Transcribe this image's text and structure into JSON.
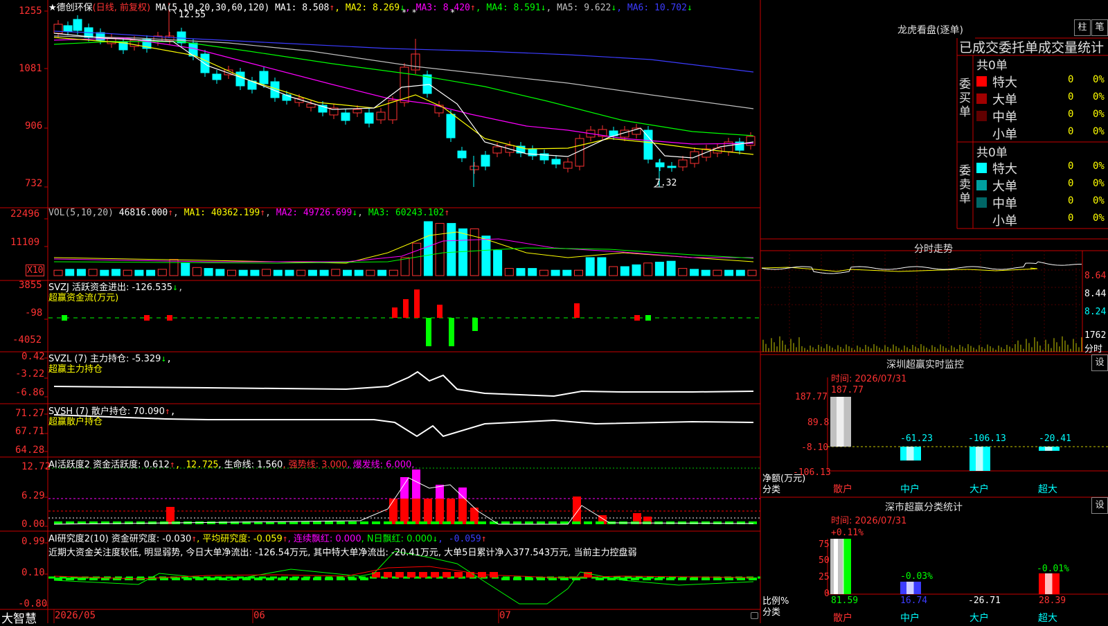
{
  "app": {
    "logo": "大智慧"
  },
  "stock": {
    "name": "★德创环保",
    "mode": "(日线, 前复权)",
    "high_marker": "12.55",
    "low_marker": "7.32"
  },
  "ma_header": {
    "prefix": "MA(5,10,20,30,60,120)",
    "items": [
      {
        "label": "MA1: 8.508",
        "arrow": "↑",
        "color": "#ffffff",
        "arrow_color": "#ff3232"
      },
      {
        "label": "MA2: 8.269",
        "arrow": "↓",
        "color": "#ffff00",
        "arrow_color": "#00ff00"
      },
      {
        "label": "MA3: 8.420",
        "arrow": "↑",
        "color": "#ff00ff",
        "arrow_color": "#ff3232"
      },
      {
        "label": "MA4: 8.591",
        "arrow": "↓",
        "color": "#00ff00",
        "arrow_color": "#00ff00"
      },
      {
        "label": "MA5: 9.622",
        "arrow": "↓",
        "color": "#c0c0c0",
        "arrow_color": "#00ff00"
      },
      {
        "label": "MA6: 10.702",
        "arrow": "↓",
        "color": "#3c3cff",
        "arrow_color": "#00ff00"
      }
    ]
  },
  "price_axis": [
    "1255",
    "1081",
    "906",
    "732"
  ],
  "vol_panel": {
    "prefix": "VOL(5,10,20)",
    "value": "46816.000",
    "ma1": "MA1: 40362.199",
    "ma2": "MA2: 49726.699",
    "ma3": "MA3: 60243.102",
    "axis": [
      "22496",
      "11109"
    ],
    "unit": "X10"
  },
  "svzj": {
    "line1": "SVZJ  活跃资金进出: -126.535",
    "arrow": "↓",
    "line2": "超赢资金流(万元)",
    "axis": [
      "3855",
      "-98",
      "-4052"
    ]
  },
  "svzl": {
    "line1": "SVZL (7) 主力持仓: -5.329",
    "arrow": "↓",
    "tail": ",",
    "line2": "超赢主力持仓",
    "axis": [
      "0.42",
      "-3.22",
      "-6.86"
    ]
  },
  "svsh": {
    "line1": "SVSH (7) 散户持仓: 70.090",
    "arrow": "↑",
    "tail": ",",
    "line2": "超赢散户持仓",
    "axis": [
      "71.27",
      "67.71",
      "64.28"
    ]
  },
  "ai_active": {
    "prefix": "AI活跃度2 资金活跃度: 0.612",
    "a1": "↑",
    "v2": ", 12.725",
    "v3": ", 生命线: 1.560",
    "v4": ", 强势线: 3.000",
    "v5": ", 爆发线: 6.000,",
    "axis": [
      "12.72",
      "6.29",
      "0.00"
    ]
  },
  "ai_research": {
    "prefix": "AI研究度2(10) 资金研究度: -0.030",
    "a1": "↑",
    "p2": ", 平均研究度: -0.059",
    "a2": "↑",
    "p3": ", 连续飘红: 0.000",
    "p4": ", N日飘红: 0.000",
    "a4": "↓",
    "p5": ", -0.059",
    "a5": "↑",
    "comment": "近期大资金关注度较低, 明显弱势, 今日大单净流出: -126.54万元, 其中特大单净流出: -20.41万元, 大单5日累计净入377.543万元, 当前主力控盘弱",
    "axis": [
      "0.99",
      "0.10",
      "-0.80"
    ]
  },
  "date_axis": [
    "2026/05",
    "06",
    "07"
  ],
  "dragon_tiger": {
    "title": "龙虎看盘(逐单)",
    "btn_col": "柱",
    "btn_tick": "笔",
    "subtitle": "已成交委托单成交量统计",
    "buy_label": "委买单",
    "sell_label": "委卖单",
    "buy_total": "共0单",
    "sell_total": "共0单",
    "buy_rows": [
      {
        "name": "特大",
        "qty": "0",
        "pct": "0%",
        "color": "#ff0000"
      },
      {
        "name": "大单",
        "qty": "0",
        "pct": "0%",
        "color": "#a00000"
      },
      {
        "name": "中单",
        "qty": "0",
        "pct": "0%",
        "color": "#600000"
      },
      {
        "name": "小单",
        "qty": "0",
        "pct": "0%",
        "color": "#000000"
      }
    ],
    "sell_rows": [
      {
        "name": "特大",
        "qty": "0",
        "pct": "0%",
        "color": "#00ffff"
      },
      {
        "name": "大单",
        "qty": "0",
        "pct": "0%",
        "color": "#00a0a0"
      },
      {
        "name": "中单",
        "qty": "0",
        "pct": "0%",
        "color": "#006666"
      },
      {
        "name": "小单",
        "qty": "0",
        "pct": "0%",
        "color": "#000000"
      }
    ]
  },
  "intraday": {
    "title": "分时走势",
    "axis": [
      "8.64",
      "8.44",
      "8.24"
    ],
    "vol_top": "1762",
    "vol_label": "分时"
  },
  "sz_realtime": {
    "title": "深圳超赢实时监控",
    "btn": "设",
    "time": "时间: 2026/07/31",
    "axis": [
      "187.77",
      "89.8",
      "-8.10",
      "-106.13"
    ],
    "top_value": "187.77",
    "unit1": "净额(万元)",
    "unit2": "分类",
    "categories": [
      {
        "name": "散户",
        "value": "",
        "label_color": "#ff3232"
      },
      {
        "name": "中户",
        "value": "-61.23",
        "label_color": "#00ffff"
      },
      {
        "name": "大户",
        "value": "-106.13",
        "label_color": "#00ffff"
      },
      {
        "name": "超大",
        "value": "-20.41",
        "label_color": "#00ffff"
      }
    ]
  },
  "sz_category": {
    "title": "深市超赢分类统计",
    "btn": "设",
    "time": "时间: 2026/07/31",
    "axis": [
      "75",
      "50",
      "25",
      "0"
    ],
    "unit1": "比例%",
    "unit2": "分类",
    "top_labels": [
      "+0.11%",
      "-0.03%",
      "-0.01%"
    ],
    "categories": [
      {
        "name": "散户",
        "value": "81.59",
        "value_color": "#00ff00"
      },
      {
        "name": "中户",
        "value": "16.74",
        "value_color": "#3c3cff"
      },
      {
        "name": "大户",
        "value": "-26.71",
        "value_color": "#ffffff"
      },
      {
        "name": "超大",
        "value": "28.39",
        "value_color": "#ff3232"
      }
    ]
  }
}
